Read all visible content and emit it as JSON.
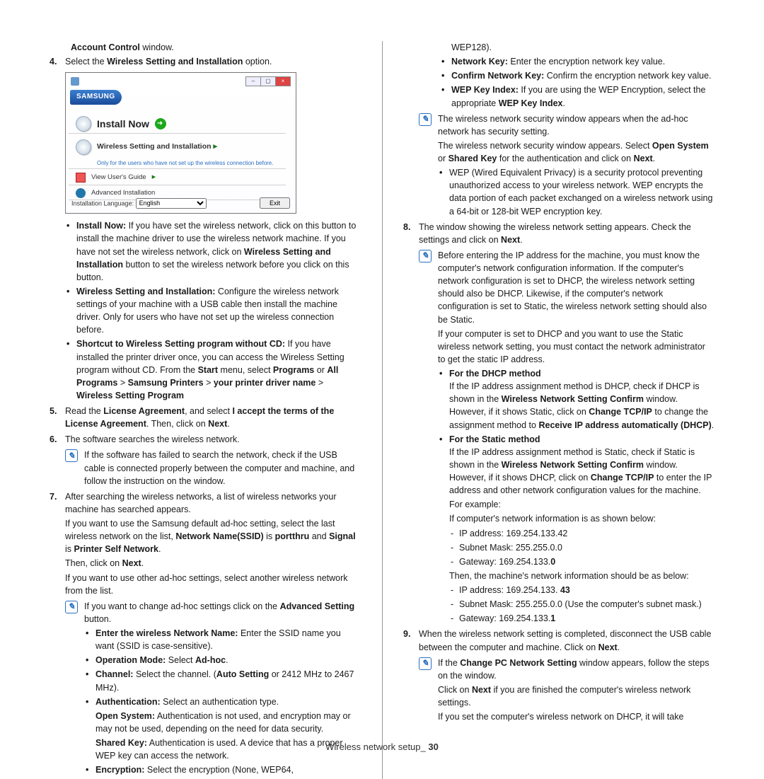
{
  "left": {
    "l1": "Account Control",
    "l1b": " window.",
    "step4_num": "4.",
    "step4a": "Select the ",
    "step4b": "Wireless Setting and Installation",
    "step4c": " option.",
    "shot": {
      "brand": "SAMSUNG",
      "install_now": "Install Now",
      "wsi": "Wireless Setting and Installation",
      "wsi_sub": "Only for the users who have not set up the wireless connection before.",
      "guide": "View User's Guide",
      "advanced": "Advanced Installation",
      "lang_label": "Installation Language:",
      "lang_value": "English",
      "exit": "Exit"
    },
    "b1a": "Install Now:",
    "b1b": "  If you have set the wireless network, click on this button to install the machine driver to use the wireless network machine. If you have not set the wireless network, click on ",
    "b1c": "Wireless Setting and Installation",
    "b1d": " button to set the wireless network before you click on this button.",
    "b2a": "Wireless Setting and Installation:",
    "b2b": "  Configure the wireless network settings of your machine with a USB cable then install the machine driver. Only for users who have not set up the wireless connection before.",
    "b3a": "Shortcut to Wireless Setting program without CD:",
    "b3b": "  If you have installed the printer driver once, you can access the Wireless Setting program without CD. From the ",
    "b3c": "Start",
    "b3d": " menu, select ",
    "b3e": "Programs",
    "b3f": " or ",
    "b3g": "All Programs",
    "b3h": " > ",
    "b3i": "Samsung Printers",
    "b3j": " > ",
    "b3k": "your printer driver name",
    "b3l": " > ",
    "b3m": "Wireless Setting Program",
    "step5_num": "5.",
    "s5a": "Read the ",
    "s5b": "License Agreement",
    "s5c": ", and select ",
    "s5d": "I accept the terms of the License Agreement",
    "s5e": ". Then, click on ",
    "s5f": "Next",
    "s5g": ".",
    "step6_num": "6.",
    "s6": "The software searches the wireless network.",
    "note6": "If the software has failed to search the network, check if the USB cable is connected properly between the computer and machine, and follow the instruction on the window.",
    "step7_num": "7.",
    "s7a": "After searching the wireless networks, a list of wireless networks your machine has searched appears.",
    "s7b1": "If you want to use the Samsung default ad-hoc setting, select the last wireless network on the list, ",
    "s7b2": "Network Name(SSID)",
    "s7b3": " is ",
    "s7b4": "portthru",
    "s7b5": " and ",
    "s7b6": "Signal",
    "s7b7": " is ",
    "s7b8": "Printer Self Network",
    "s7b9": ".",
    "s7c1": "Then, click on ",
    "s7c2": "Next",
    "s7c3": ".",
    "s7d": "If you want to use other ad-hoc settings, select another wireless network from the list.",
    "note7a": "If you want to change ad-hoc settings click on the ",
    "note7b": "Advanced Setting",
    "note7c": " button.",
    "n7_1a": "Enter the wireless Network Name:",
    "n7_1b": "  Enter the SSID name you want (SSID is case-sensitive).",
    "n7_2a": "Operation Mode:",
    "n7_2b": "  Select ",
    "n7_2c": "Ad-hoc",
    "n7_2d": ".",
    "n7_3a": "Channel:",
    "n7_3b": "  Select the channel. (",
    "n7_3c": "Auto Setting",
    "n7_3d": " or 2412 MHz to 2467 MHz).",
    "n7_4a": "Authentication:",
    "n7_4b": "  Select an authentication type.",
    "n7_4c": "Open System:",
    "n7_4d": "  Authentication is not used, and encryption may or may not be used, depending on the need for data security.",
    "n7_4e": "Shared Key:",
    "n7_4f": "  Authentication is used. A device that has a proper WEP key can access the network.",
    "n7_5a": "Encryption:",
    "n7_5b": "  Select the encryption (None, WEP64,"
  },
  "right": {
    "r0": "WEP128).",
    "r1a": "Network Key:",
    "r1b": "  Enter the encryption network key value.",
    "r2a": "Confirm Network Key:",
    "r2b": "  Confirm the encryption network key value.",
    "r3a": "WEP Key Index:",
    "r3b": "  If you are using the WEP Encryption, select the appropriate ",
    "r3c": "WEP Key Index",
    "r3d": ".",
    "noteA1": "The wireless network security window appears when the ad-hoc network has security setting.",
    "noteA2a": "The wireless network security window appears. Select ",
    "noteA2b": "Open System",
    "noteA2c": " or ",
    "noteA2d": "Shared Key",
    "noteA2e": " for the authentication and click on ",
    "noteA2f": "Next",
    "noteA2g": ".",
    "noteA3": "WEP (Wired Equivalent Privacy) is a security protocol preventing unauthorized access to your wireless network. WEP encrypts the data portion of each packet exchanged on a wireless network using a 64-bit or 128-bit WEP encryption key.",
    "step8_num": "8.",
    "s8a": "The window showing the wireless network setting appears. Check the settings and click on ",
    "s8b": "Next",
    "s8c": ".",
    "noteB1": "Before entering the IP address for the machine, you must know the computer's network configuration information. If the computer's network configuration is set to DHCP, the wireless network setting should also be DHCP. Likewise, if the computer's network configuration is set to Static, the wireless network setting should also be Static.",
    "noteB2": "If your computer is set to DHCP and you want to use the Static wireless network setting, you must contact the network administrator to get the static IP address.",
    "dhcp_h": "For the DHCP method",
    "dhcp_a": "If the IP address assignment method is DHCP, check if DHCP is shown in the ",
    "dhcp_b": "Wireless Network Setting Confirm",
    "dhcp_c": " window. However, if it shows Static, click on ",
    "dhcp_d": "Change TCP/IP",
    "dhcp_e": " to change the assignment method to ",
    "dhcp_f": "Receive IP address automatically (DHCP)",
    "dhcp_g": ".",
    "stat_h": "For the Static method",
    "stat_a": "If the IP address assignment method is Static, check if Static is shown in the ",
    "stat_b": "Wireless Network Setting Confirm",
    "stat_c": " window. However, if it shows DHCP, click on ",
    "stat_d": "Change TCP/IP",
    "stat_e": " to enter the IP address and other network configuration values for the machine.",
    "stat_f": "For example:",
    "stat_g": "If computer's network information is as shown below:",
    "stat_ip": "IP address: 169.254.133.42",
    "stat_mask": "Subnet Mask: 255.255.0.0",
    "stat_gw1": "Gateway: 169.254.133.",
    "stat_gw2": "0",
    "stat_h2": "Then, the machine's network information should be as below:",
    "m_ip1": "IP address: 169.254.133. ",
    "m_ip2": "43",
    "m_mask": "Subnet Mask: 255.255.0.0 (Use the computer's subnet mask.)",
    "m_gw1": "Gateway: 169.254.133.",
    "m_gw2": "1",
    "step9_num": "9.",
    "s9a": "When the wireless network setting is completed, disconnect the USB cable between the computer and machine. Click on ",
    "s9b": "Next",
    "s9c": ".",
    "noteC1a": "If the ",
    "noteC1b": "Change PC Network Setting",
    "noteC1c": " window appears, follow the steps on the window.",
    "noteC2a": "Click on ",
    "noteC2b": "Next",
    "noteC2c": " if you are finished the computer's wireless network settings.",
    "noteC3": "If you set the computer's wireless network on DHCP, it will take"
  },
  "footer": {
    "a": "Wireless network setup",
    "b": "_ ",
    "c": "30"
  }
}
